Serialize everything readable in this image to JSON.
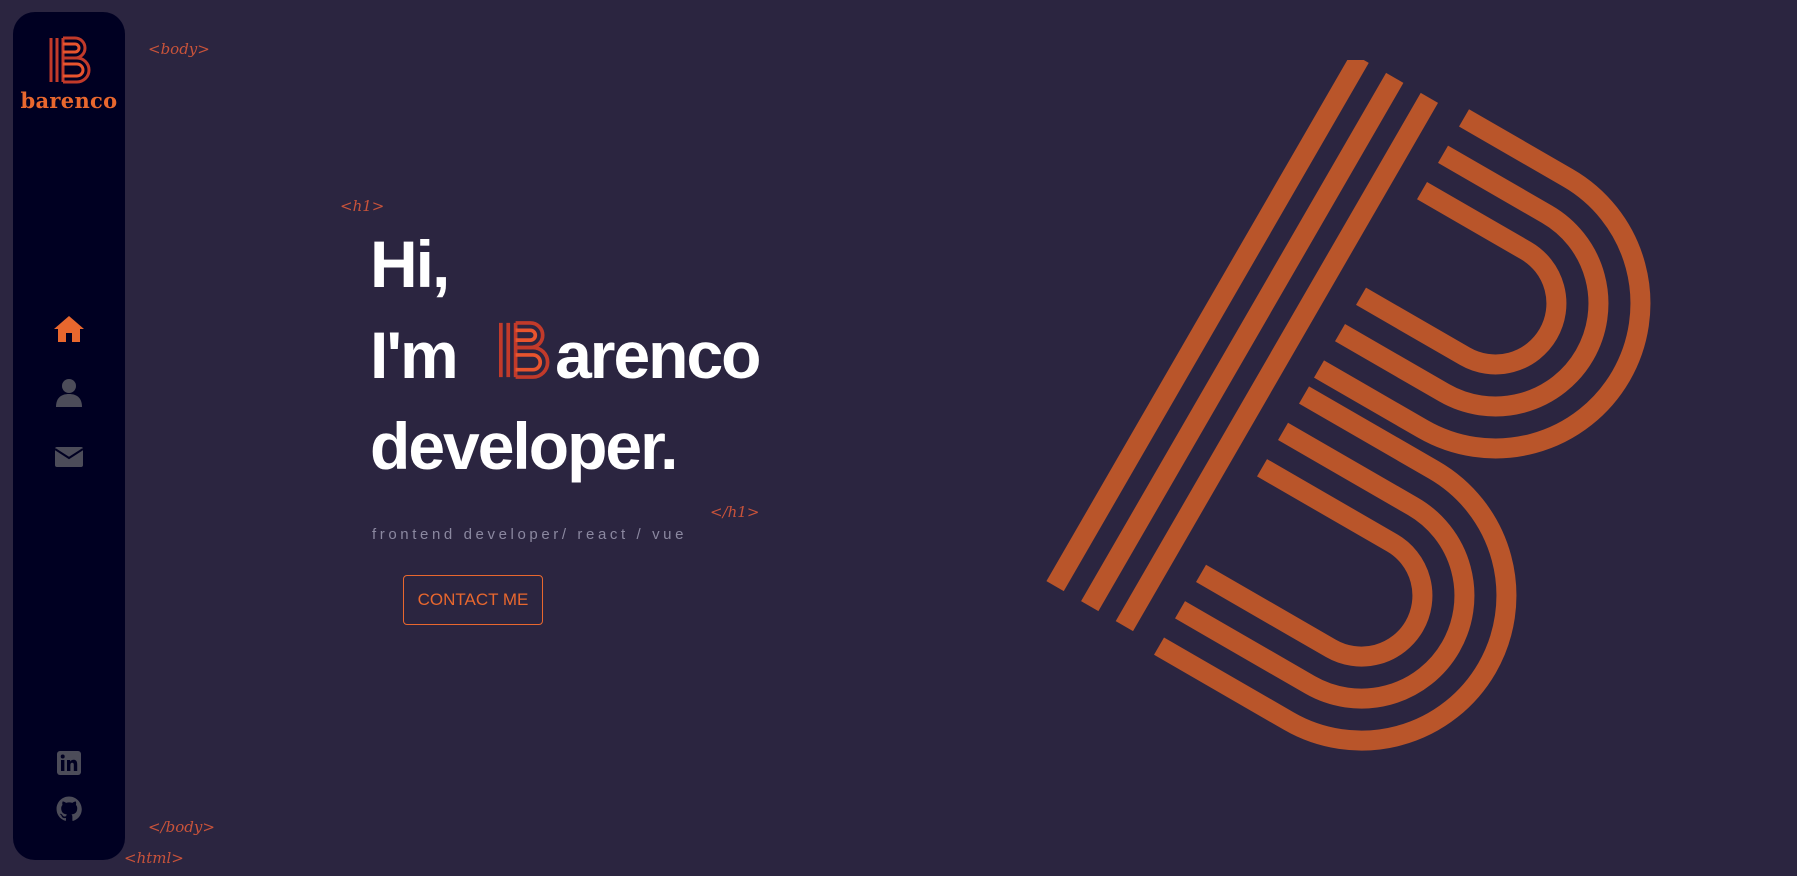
{
  "brand": {
    "name": "barenco"
  },
  "tags": {
    "body_open": "<body>",
    "h1_open": "<h1>",
    "h1_close": "</h1>",
    "body_close": "</body>",
    "html_close": "<html>"
  },
  "nav": {
    "items": [
      {
        "icon": "home-icon",
        "active": true
      },
      {
        "icon": "user-icon",
        "active": false
      },
      {
        "icon": "envelope-icon",
        "active": false
      }
    ]
  },
  "social": [
    {
      "icon": "linkedin-icon"
    },
    {
      "icon": "github-icon"
    }
  ],
  "hero": {
    "line1": "Hi,",
    "line2_prefix": "I'm",
    "line2_rest": "arenco",
    "line3": "developer.",
    "subtitle": "frontend developer/ react / vue",
    "cta_label": "CONTACT ME"
  },
  "colors": {
    "background": "#2b2540",
    "sidebar": "#000022",
    "accent": "#e8672e",
    "big_logo": "#b9552a",
    "nav_inactive": "#4c4c59"
  }
}
